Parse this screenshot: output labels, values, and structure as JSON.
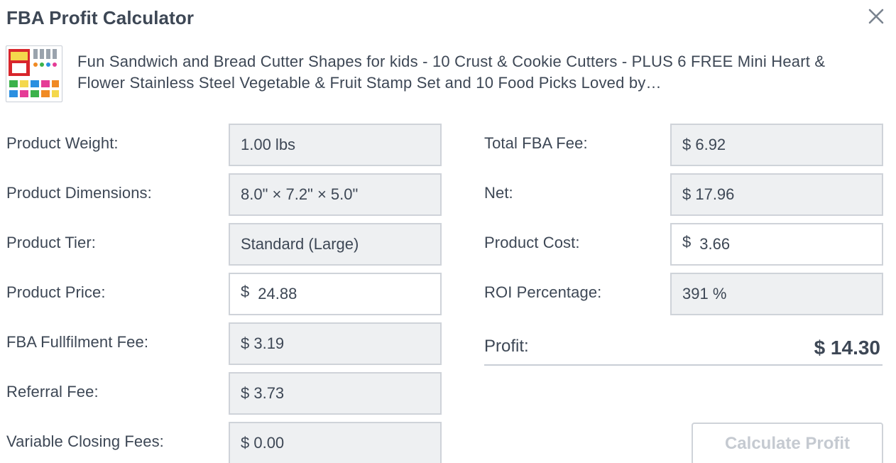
{
  "dialog": {
    "title": "FBA Profit Calculator",
    "close_icon": "close-icon"
  },
  "product": {
    "title": "Fun Sandwich and Bread Cutter Shapes for kids - 10 Crust & Cookie Cutters - PLUS 6 FREE Mini Heart & Flower Stainless Steel Vegetable & Fruit Stamp Set and 10 Food Picks Loved by…",
    "thumbnail_icon": "product-thumbnail"
  },
  "left": {
    "weight": {
      "label": "Product Weight:",
      "value": "1.00 lbs"
    },
    "dimensions": {
      "label": "Product Dimensions:",
      "value": "8.0\" × 7.2\" × 5.0\""
    },
    "tier": {
      "label": "Product Tier:",
      "value": "Standard (Large)"
    },
    "price": {
      "label": "Product Price:",
      "currency": "$",
      "value": "24.88"
    },
    "fulfilment_fee": {
      "label": "FBA Fullfilment Fee:",
      "value": "$ 3.19"
    },
    "referral_fee": {
      "label": "Referral Fee:",
      "value": "$ 3.73"
    },
    "closing_fees": {
      "label": "Variable Closing Fees:",
      "value": "$ 0.00"
    }
  },
  "right": {
    "total_fba_fee": {
      "label": "Total FBA Fee:",
      "value": "$ 6.92"
    },
    "net": {
      "label": "Net:",
      "value": "$ 17.96"
    },
    "cost": {
      "label": "Product Cost:",
      "currency": "$",
      "value": "3.66"
    },
    "roi": {
      "label": "ROI Percentage:",
      "value": "391 %"
    },
    "profit": {
      "label": "Profit:",
      "value": "$ 14.30"
    }
  },
  "actions": {
    "calculate_label": "Calculate Profit"
  },
  "colors": {
    "text": "#3d4755",
    "readonly_bg": "#eef0f2",
    "border": "#cfd3d9",
    "button_disabled_text": "#c5cad1"
  }
}
